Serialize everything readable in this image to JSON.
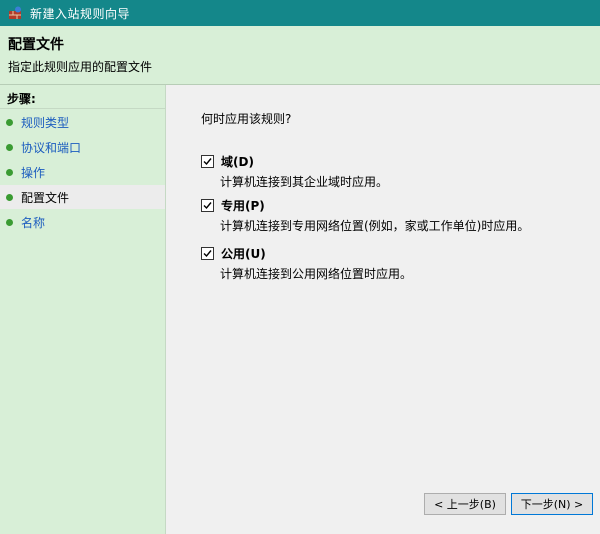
{
  "window": {
    "title": "新建入站规则向导"
  },
  "header": {
    "title": "配置文件",
    "subtitle": "指定此规则应用的配置文件"
  },
  "sidebar": {
    "heading": "步骤:",
    "steps": [
      {
        "label": "规则类型"
      },
      {
        "label": "协议和端口"
      },
      {
        "label": "操作"
      },
      {
        "label": "配置文件"
      },
      {
        "label": "名称"
      }
    ]
  },
  "main": {
    "question": "何时应用该规则?",
    "options": [
      {
        "label": "域(D)",
        "description": "计算机连接到其企业域时应用。",
        "checked": true
      },
      {
        "label": "专用(P)",
        "description": "计算机连接到专用网络位置(例如，家或工作单位)时应用。",
        "checked": true
      },
      {
        "label": "公用(U)",
        "description": "计算机连接到公用网络位置时应用。",
        "checked": true
      }
    ]
  },
  "buttons": {
    "back": "< 上一步(B)",
    "next": "下一步(N) >"
  },
  "colors": {
    "titlebar": "#14878a",
    "panel": "#d8efd7",
    "link": "#1c5dbf",
    "bullet": "#3a9b32"
  }
}
